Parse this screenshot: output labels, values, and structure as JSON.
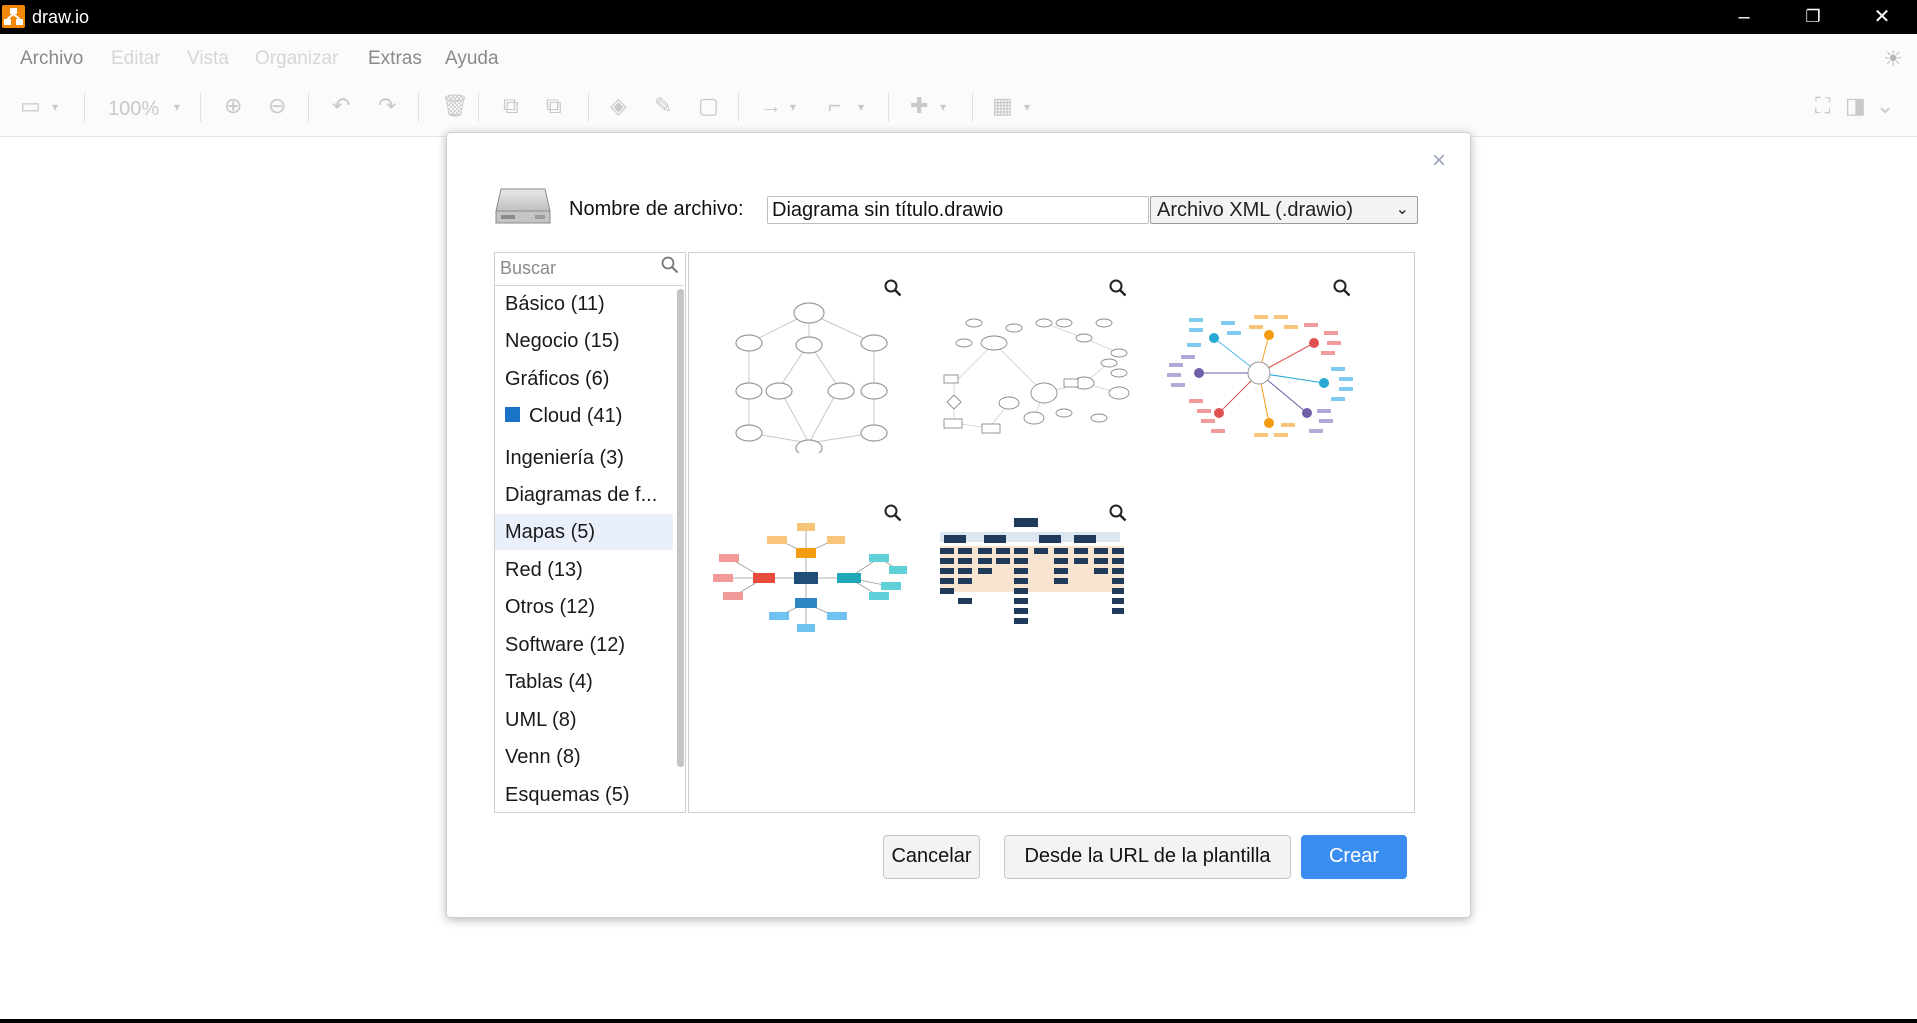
{
  "app": {
    "title": "draw.io",
    "accent": "#f08705"
  },
  "window_controls": {
    "minimize": "–",
    "restore": "❐",
    "close": "✕"
  },
  "menu": {
    "items": [
      "Archivo",
      "Editar",
      "Vista",
      "Organizar",
      "Extras",
      "Ayuda"
    ],
    "theme_icon": "☀"
  },
  "toolbar": {
    "zoom": "100%",
    "icons": [
      "sidebar-icon",
      "zoom-in-icon",
      "zoom-out-icon",
      "undo-icon",
      "redo-icon",
      "delete-icon",
      "to-front-icon",
      "to-back-icon",
      "fill-color-icon",
      "line-color-icon",
      "shadow-icon",
      "connection-icon",
      "waypoints-icon",
      "insert-icon",
      "table-icon",
      "fullscreen-icon",
      "format-panel-icon",
      "collapse-icon"
    ]
  },
  "dialog": {
    "close": "×",
    "filename_label": "Nombre de archivo:",
    "filename_value": "Diagrama sin título.drawio",
    "format_selected": "Archivo XML (.drawio)",
    "search_placeholder": "Buscar",
    "categories": [
      {
        "label": "Básico (11)"
      },
      {
        "label": "Negocio (15)"
      },
      {
        "label": "Gráficos (6)"
      },
      {
        "label": "Cloud (41)"
      },
      {
        "label": "Ingeniería (3)"
      },
      {
        "label": "Diagramas de f..."
      },
      {
        "label": "Mapas (5)",
        "selected": true
      },
      {
        "label": "Red (13)"
      },
      {
        "label": "Otros (12)"
      },
      {
        "label": "Software (12)"
      },
      {
        "label": "Tablas (4)"
      },
      {
        "label": "UML (8)"
      },
      {
        "label": "Venn (8)"
      },
      {
        "label": "Esquemas (5)"
      }
    ],
    "templates": [
      {
        "name": "mind-map-oval"
      },
      {
        "name": "concept-map"
      },
      {
        "name": "radial-map-colored"
      },
      {
        "name": "mind-map-colored-boxes"
      },
      {
        "name": "org-tree-map"
      }
    ],
    "buttons": {
      "cancel": "Cancelar",
      "from_url": "Desde la URL de la plantilla",
      "create": "Crear"
    },
    "create_color": "#3b8ef1"
  }
}
